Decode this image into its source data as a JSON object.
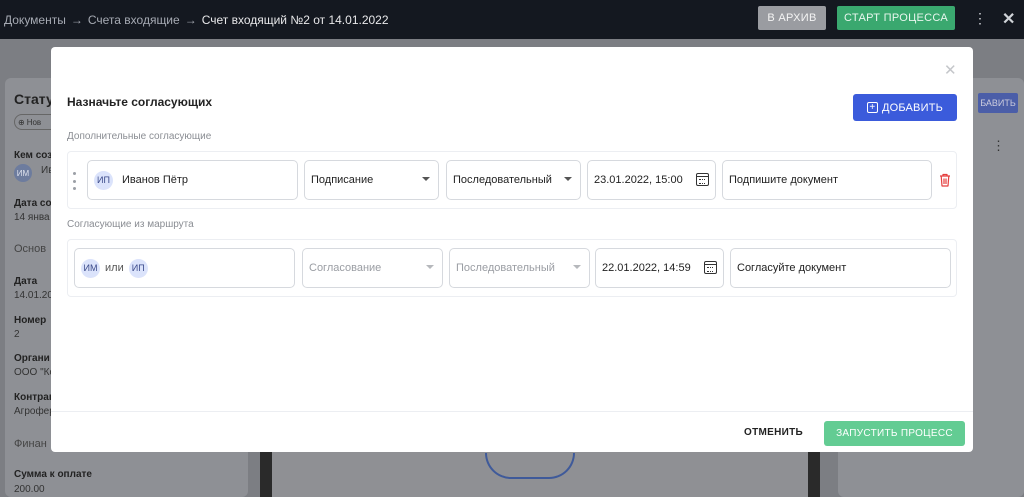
{
  "header": {
    "breadcrumbs": [
      "Документы",
      "Счета входящие",
      "Счет входящий №2 от 14.01.2022"
    ],
    "arrow": "→",
    "archive_label": "В АРХИВ",
    "start_label": "СТАРТ ПРОЦЕССА",
    "more_glyph": "⋮",
    "close_glyph": "✕"
  },
  "left_panel": {
    "title": "Стату",
    "new_button": "Нов",
    "created_by_label": "Кем соз",
    "created_by_avatar": "ИМ",
    "created_by_value": "Ив",
    "date_created_label": "Дата со",
    "date_created_value": "14 янва",
    "section_main": "Основ",
    "date_label": "Дата",
    "date_value": "14.01.20",
    "number_label": "Номер",
    "number_value": "2",
    "org_label": "Органи",
    "org_value": "ООО \"Ко",
    "counterparty_label": "Контраг",
    "counterparty_value": "Агрофер",
    "section_finance": "Финан",
    "amount_label": "Сумма к оплате",
    "amount_value": "200.00"
  },
  "right_panel": {
    "add_button": "БАВИТЬ",
    "more_glyph": "⋮"
  },
  "modal": {
    "close_glyph": "✕",
    "title": "Назначьте согласующих",
    "add_button_label": "ДОБАВИТЬ",
    "add_button_icon": "plus-square-icon",
    "section_additional": "Дополнительные согласующие",
    "section_route": "Согласующие из маршрута",
    "additional_rows": [
      {
        "approver_initials": "ИП",
        "approver_name": "Иванов Пётр",
        "action": "Подписание",
        "order": "Последовательный",
        "deadline": "23.01.2022, 15:00",
        "comment": "Подпишите документ"
      }
    ],
    "route_rows": [
      {
        "approver_initials_1": "ИМ",
        "or_word": "или",
        "approver_initials_2": "ИП",
        "action": "Согласование",
        "order": "Последовательный",
        "deadline": "22.01.2022, 14:59",
        "comment": "Согласуйте документ"
      }
    ],
    "cancel_label": "ОТМЕНИТЬ",
    "run_label": "ЗАПУСТИТЬ ПРОЦЕСС",
    "colors": {
      "primary": "#3b5bdb",
      "success": "#63cc93",
      "danger": "#e53e3e"
    }
  }
}
